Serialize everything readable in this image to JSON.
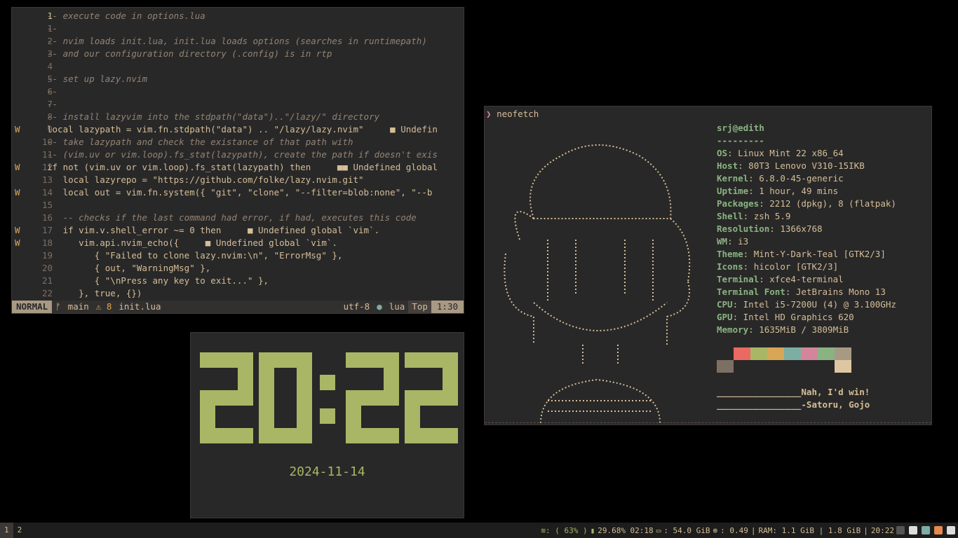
{
  "editor": {
    "lines": [
      {
        "sign": "",
        "num": "1",
        "html_class": "cm",
        "text": "-- execute code in options.lua"
      },
      {
        "sign": "",
        "num": "1",
        "html_class": "cm",
        "text": "--"
      },
      {
        "sign": "",
        "num": "2",
        "html_class": "cm",
        "text": "-- nvim loads init.lua, init.lua loads options (searches in runtimepath)"
      },
      {
        "sign": "",
        "num": "3",
        "html_class": "cm",
        "text": "-- and our configuration directory (.config) is in rtp"
      },
      {
        "sign": "",
        "num": "4",
        "html_class": "",
        "text": ""
      },
      {
        "sign": "",
        "num": "5",
        "html_class": "cm",
        "text": "-- set up lazy.nvim"
      },
      {
        "sign": "",
        "num": "6",
        "html_class": "cm",
        "text": "--"
      },
      {
        "sign": "",
        "num": "7",
        "html_class": "cm",
        "text": "--"
      },
      {
        "sign": "",
        "num": "8",
        "html_class": "cm",
        "text": "-- install lazyvim into the stdpath(\"data\")..\"/lazy/\" directory"
      },
      {
        "sign": "W",
        "num": "9",
        "html_class": "var",
        "text": "local lazypath = vim.fn.stdpath(\"data\") .. \"/lazy/lazy.nvim\"     ■ Undefin"
      },
      {
        "sign": "",
        "num": "10",
        "html_class": "cm",
        "text": "-- take lazypath and check the existance of that path with"
      },
      {
        "sign": "",
        "num": "11",
        "html_class": "cm",
        "text": "-- (vim.uv or vim.loop).fs_stat(lazypath), create the path if doesn't exis"
      },
      {
        "sign": "W",
        "num": "12",
        "html_class": "var",
        "text": "if not (vim.uv or vim.loop).fs_stat(lazypath) then     ■■ Undefined global"
      },
      {
        "sign": "",
        "num": "13",
        "html_class": "var",
        "text": "   local lazyrepo = \"https://github.com/folke/lazy.nvim.git\""
      },
      {
        "sign": "W",
        "num": "14",
        "html_class": "var",
        "text": "   local out = vim.fn.system({ \"git\", \"clone\", \"--filter=blob:none\", \"--b"
      },
      {
        "sign": "",
        "num": "15",
        "html_class": "",
        "text": ""
      },
      {
        "sign": "",
        "num": "16",
        "html_class": "cm",
        "text": "   -- checks if the last command had error, if had, executes this code"
      },
      {
        "sign": "W",
        "num": "17",
        "html_class": "var",
        "text": "   if vim.v.shell_error ~= 0 then     ■ Undefined global `vim`."
      },
      {
        "sign": "W",
        "num": "18",
        "html_class": "var",
        "text": "      vim.api.nvim_echo({     ■ Undefined global `vim`."
      },
      {
        "sign": "",
        "num": "19",
        "html_class": "var",
        "text": "         { \"Failed to clone lazy.nvim:\\n\", \"ErrorMsg\" },"
      },
      {
        "sign": "",
        "num": "20",
        "html_class": "var",
        "text": "         { out, \"WarningMsg\" },"
      },
      {
        "sign": "",
        "num": "21",
        "html_class": "var",
        "text": "         { \"\\nPress any key to exit...\" },"
      },
      {
        "sign": "",
        "num": "22",
        "html_class": "var",
        "text": "      }, true, {})"
      }
    ],
    "status": {
      "mode": "NORMAL",
      "branch": "main",
      "warnings": "⚠ 8",
      "file": "init.lua",
      "encoding": "utf-8",
      "filetype": "lua",
      "scroll": "Top",
      "position": "1:30"
    }
  },
  "clock": {
    "time": "20:22",
    "date": "2024-11-14",
    "color": "#a9b665"
  },
  "neofetch": {
    "prompt": "neofetch",
    "user": "srj@edith",
    "separator": "---------",
    "info": [
      {
        "k": "OS",
        "v": "Linux Mint 22 x86_64"
      },
      {
        "k": "Host",
        "v": "80T3 Lenovo V310-15IKB"
      },
      {
        "k": "Kernel",
        "v": "6.8.0-45-generic"
      },
      {
        "k": "Uptime",
        "v": "1 hour, 49 mins"
      },
      {
        "k": "Packages",
        "v": "2212 (dpkg), 8 (flatpak)"
      },
      {
        "k": "Shell",
        "v": "zsh 5.9"
      },
      {
        "k": "Resolution",
        "v": "1366x768"
      },
      {
        "k": "WM",
        "v": "i3"
      },
      {
        "k": "Theme",
        "v": "Mint-Y-Dark-Teal [GTK2/3]"
      },
      {
        "k": "Icons",
        "v": "hicolor [GTK2/3]"
      },
      {
        "k": "Terminal",
        "v": "xfce4-terminal"
      },
      {
        "k": "Terminal Font",
        "v": "JetBrains Mono 13"
      },
      {
        "k": "CPU",
        "v": "Intel i5-7200U (4) @ 3.100GHz"
      },
      {
        "k": "GPU",
        "v": "Intel HD Graphics 620"
      },
      {
        "k": "Memory",
        "v": "1635MiB / 3809MiB"
      }
    ],
    "palette_top": [
      "#292828",
      "#ea6962",
      "#a9b665",
      "#d8a657",
      "#7daea3",
      "#d3869b",
      "#89b482",
      "#a89984"
    ],
    "palette_bottom": [
      "#7c6f64",
      "#292828",
      "#292828",
      "#292828",
      "#292828",
      "#292828",
      "#292828",
      "#ddc7a1"
    ],
    "quote1": "________________Nah, I'd win!",
    "quote2": "________________-Satoru, Gojo"
  },
  "bar": {
    "workspaces": [
      "1",
      "2"
    ],
    "wifi": ": ( 63% )",
    "battery": "29.68% 02:18",
    "disk": ": 54.0 GiB",
    "load": ": 0.49",
    "ram": "RAM: 1.1 GiB | 1.8 GiB",
    "time": "20:22"
  }
}
